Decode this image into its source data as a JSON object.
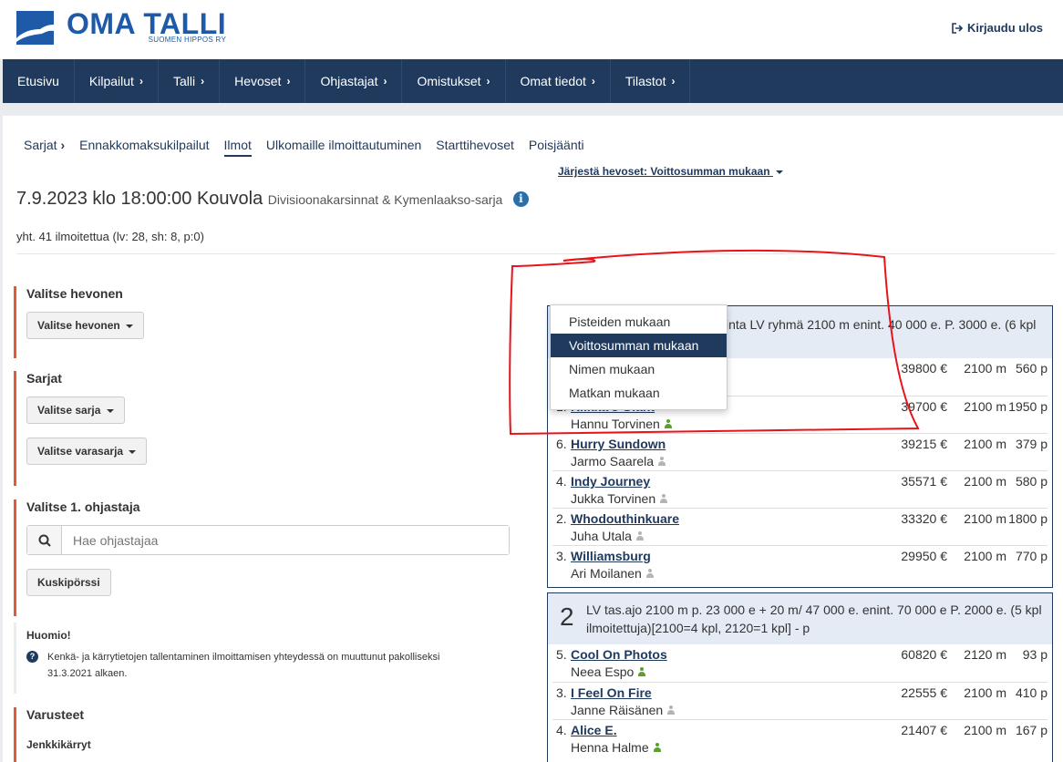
{
  "header": {
    "logo_title": "OMA TALLI",
    "logo_subtitle": "SUOMEN HIPPOS RY",
    "logout_label": "Kirjaudu ulos"
  },
  "nav": [
    {
      "label": "Etusivu",
      "chevron": false
    },
    {
      "label": "Kilpailut",
      "chevron": true
    },
    {
      "label": "Talli",
      "chevron": true
    },
    {
      "label": "Hevoset",
      "chevron": true
    },
    {
      "label": "Ohjastajat",
      "chevron": true
    },
    {
      "label": "Omistukset",
      "chevron": true
    },
    {
      "label": "Omat tiedot",
      "chevron": true
    },
    {
      "label": "Tilastot",
      "chevron": true
    }
  ],
  "subnav": {
    "sarjat": "Sarjat",
    "ennakko": "Ennakkomaksukilpailut",
    "ilmot": "Ilmot",
    "ulkomaille": "Ulkomaille ilmoittautuminen",
    "startti": "Starttihevoset",
    "poisjaanti": "Poisjäänti"
  },
  "page": {
    "title": "7.9.2023 klo 18:00:00 Kouvola",
    "subtitle": "Divisioonakarsinnat & Kymenlaakso-sarja",
    "summary": "yht. 41 ilmoitettua (lv: 28, sh: 8, p:0)"
  },
  "left": {
    "horse_heading": "Valitse hevonen",
    "horse_button": "Valitse hevonen",
    "series_heading": "Sarjat",
    "series_button": "Valitse sarja",
    "reserve_button": "Valitse varasarja",
    "driver_heading": "Valitse 1. ohjastaja",
    "driver_placeholder": "Hae ohjastajaa",
    "driver_market_button": "Kuskipörssi",
    "notice_heading": "Huomio!",
    "notice_text_1": "Kenkä- ja kärrytietojen tallentaminen ilmoittamisen yhteydessä on muuttunut pakolliseksi",
    "notice_text_2": "31.3.2021 alkaen.",
    "equipment_heading": "Varusteet",
    "cart_label": "Jenkkikärryt"
  },
  "sort": {
    "label": "Järjestä hevoset: Voittosumman mukaan",
    "options": [
      "Pisteiden mukaan",
      "Voittosumman mukaan",
      "Nimen mukaan",
      "Matkan mukaan"
    ],
    "selected_index": 1
  },
  "races": [
    {
      "number": "",
      "title": "inta LV ryhmä 2100 m enint. 40 000 e. P. 3000 e. (6 kpl",
      "horses": [
        {
          "pos": "",
          "name": "",
          "driver": "",
          "driver_active": false,
          "money": "39800 €",
          "dist": "2100 m",
          "pts": "560 p"
        },
        {
          "pos": "1.",
          "name": "Riikka's Giant",
          "driver": "Hannu Torvinen",
          "driver_active": true,
          "money": "39700 €",
          "dist": "2100 m",
          "pts": "1950 p"
        },
        {
          "pos": "6.",
          "name": "Hurry Sundown",
          "driver": "Jarmo Saarela",
          "driver_active": false,
          "money": "39215 €",
          "dist": "2100 m",
          "pts": "379 p"
        },
        {
          "pos": "4.",
          "name": "Indy Journey",
          "driver": "Jukka Torvinen",
          "driver_active": false,
          "money": "35571 €",
          "dist": "2100 m",
          "pts": "580 p"
        },
        {
          "pos": "2.",
          "name": "Whodouthinkuare",
          "driver": "Juha Utala",
          "driver_active": false,
          "money": "33320 €",
          "dist": "2100 m",
          "pts": "1800 p"
        },
        {
          "pos": "3.",
          "name": "Williamsburg",
          "driver": "Ari Moilanen",
          "driver_active": false,
          "money": "29950 €",
          "dist": "2100 m",
          "pts": "770 p"
        }
      ]
    },
    {
      "number": "2",
      "title": "LV tas.ajo 2100 m p. 23 000 e + 20 m/ 47 000 e. enint. 70 000 e P. 2000 e. (5 kpl ilmoitettuja)[2100=4 kpl, 2120=1 kpl] - p",
      "horses": [
        {
          "pos": "5.",
          "name": "Cool On Photos",
          "driver": "Neea Espo",
          "driver_active": true,
          "money": "60820 €",
          "dist": "2120 m",
          "pts": "93 p"
        },
        {
          "pos": "3.",
          "name": "I Feel On Fire",
          "driver": "Janne Räisänen",
          "driver_active": false,
          "money": "22555 €",
          "dist": "2100 m",
          "pts": "410 p"
        },
        {
          "pos": "4.",
          "name": "Alice E.",
          "driver": "Henna Halme",
          "driver_active": true,
          "money": "21407 €",
          "dist": "2100 m",
          "pts": "167 p"
        }
      ]
    }
  ],
  "colors": {
    "navy": "#203a5e",
    "accent_red": "#e05a3c",
    "annotation_red": "#e8141c",
    "active_driver": "#5aa02c",
    "inactive_driver": "#b5b5b5"
  }
}
